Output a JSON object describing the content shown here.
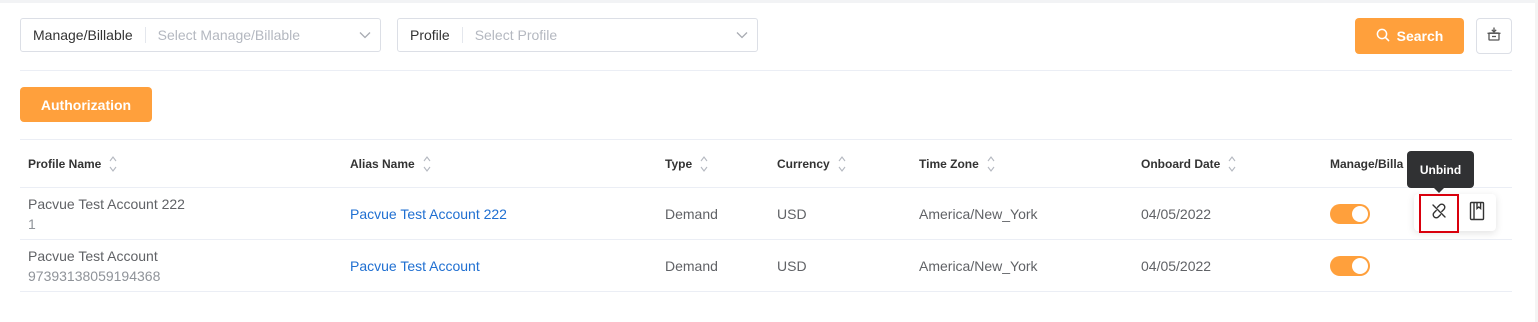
{
  "filters": {
    "manage_label": "Manage/Billable",
    "manage_placeholder": "Select Manage/Billable",
    "profile_label": "Profile",
    "profile_placeholder": "Select Profile"
  },
  "toolbar": {
    "search_label": "Search",
    "search_icon": "search-icon",
    "export_icon": "download-icon"
  },
  "authorization_label": "Authorization",
  "table": {
    "columns": [
      "Profile Name",
      "Alias Name",
      "Type",
      "Currency",
      "Time Zone",
      "Onboard Date",
      "Manage/Billa"
    ],
    "rows": [
      {
        "profile_name": "Pacvue Test Account 222",
        "profile_id": "1",
        "alias": "Pacvue Test Account 222",
        "type": "Demand",
        "currency": "USD",
        "timezone": "America/New_York",
        "onboard_date": "04/05/2022",
        "manage_billable_on": true
      },
      {
        "profile_name": "Pacvue Test Account",
        "profile_id": "97393138059194368",
        "alias": "Pacvue Test Account",
        "type": "Demand",
        "currency": "USD",
        "timezone": "America/New_York",
        "onboard_date": "04/05/2022",
        "manage_billable_on": true
      }
    ]
  },
  "tooltip": "Unbind",
  "actions": {
    "unbind_icon": "unlink-icon",
    "book_icon": "book-icon"
  },
  "colors": {
    "accent": "#ffa03c",
    "link": "#1f6fd1",
    "highlight_border": "#d9000d",
    "tooltip_bg": "#303133"
  }
}
